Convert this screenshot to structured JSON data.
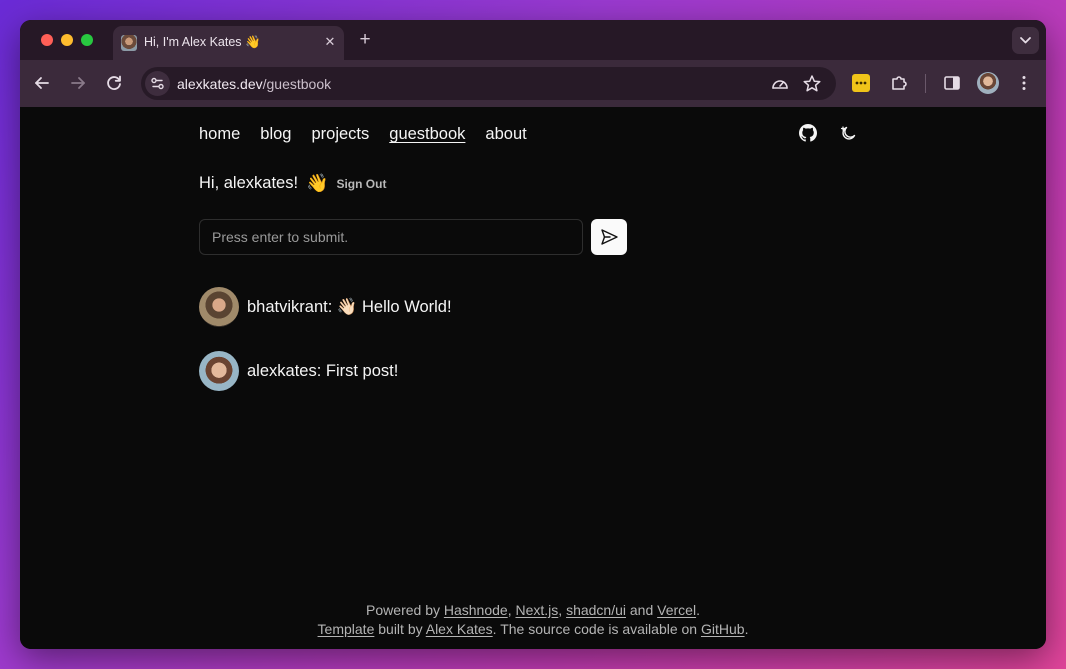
{
  "browser": {
    "tab": {
      "title": "Hi, I'm Alex Kates 👋",
      "close_glyph": "✕"
    },
    "new_tab_glyph": "+",
    "url": {
      "domain": "alexkates.dev",
      "path": "/guestbook"
    }
  },
  "nav": {
    "links": [
      "home",
      "blog",
      "projects",
      "guestbook",
      "about"
    ],
    "active": "guestbook"
  },
  "guestbook": {
    "greeting": "Hi, alexkates!",
    "wave_emoji": "👋",
    "sign_out_label": "Sign Out",
    "input_placeholder": "Press enter to submit.",
    "entries": [
      {
        "text": "bhatvikrant: 👋🏻 Hello World!"
      },
      {
        "text": "alexkates: First post!"
      }
    ]
  },
  "footer": {
    "line1": {
      "prefix": "Powered by ",
      "hashnode": "Hashnode",
      "sep1": ", ",
      "nextjs": "Next.js",
      "sep2": ", ",
      "shadcn": "shadcn/ui",
      "sep3": " and ",
      "vercel": "Vercel",
      "end": "."
    },
    "line2": {
      "template": "Template",
      "built_by": " built by ",
      "author": "Alex Kates",
      "mid": ". The source code is available on ",
      "github": "GitHub",
      "end": "."
    }
  },
  "colors": {
    "page_bg": "#0a0a0a",
    "text": "#f5f5f5",
    "muted": "#b4b4b4",
    "browser_chrome": "#3b2a3b"
  }
}
